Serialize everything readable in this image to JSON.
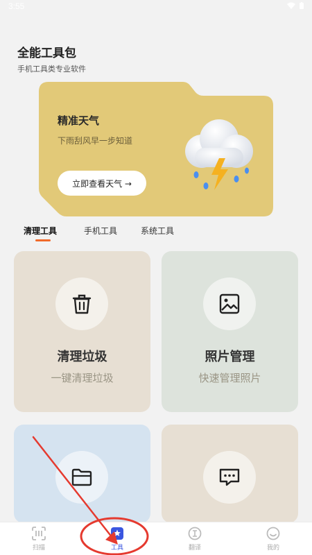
{
  "status": {
    "time": "3:55"
  },
  "header": {
    "title": "全能工具包",
    "subtitle": "手机工具类专业软件"
  },
  "weather": {
    "title": "精准天气",
    "description": "下雨刮风早一步知道",
    "button_label": "立即查看天气 →",
    "card_color": "#e2c978"
  },
  "tabs": [
    {
      "label": "清理工具",
      "active": true
    },
    {
      "label": "手机工具",
      "active": false
    },
    {
      "label": "系统工具",
      "active": false
    }
  ],
  "tools": [
    {
      "title": "清理垃圾",
      "subtitle": "一键清理垃圾",
      "icon": "trash-icon",
      "color": "#e7dfd3"
    },
    {
      "title": "照片管理",
      "subtitle": "快速管理照片",
      "icon": "image-icon",
      "color": "#dde3dc"
    },
    {
      "title": "",
      "subtitle": "",
      "icon": "folder-icon",
      "color": "#d5e3f0"
    },
    {
      "title": "",
      "subtitle": "",
      "icon": "message-icon",
      "color": "#e7dfd3"
    }
  ],
  "nav": [
    {
      "label": "扫描",
      "icon": "scan-icon",
      "active": false
    },
    {
      "label": "工具",
      "icon": "tools-icon",
      "active": true
    },
    {
      "label": "翻译",
      "icon": "translate-icon",
      "active": false
    },
    {
      "label": "我的",
      "icon": "profile-icon",
      "active": false
    }
  ],
  "colors": {
    "accent": "#3a56e0",
    "tab_indicator": "#f06a2a",
    "annotation": "#e53a2f"
  }
}
